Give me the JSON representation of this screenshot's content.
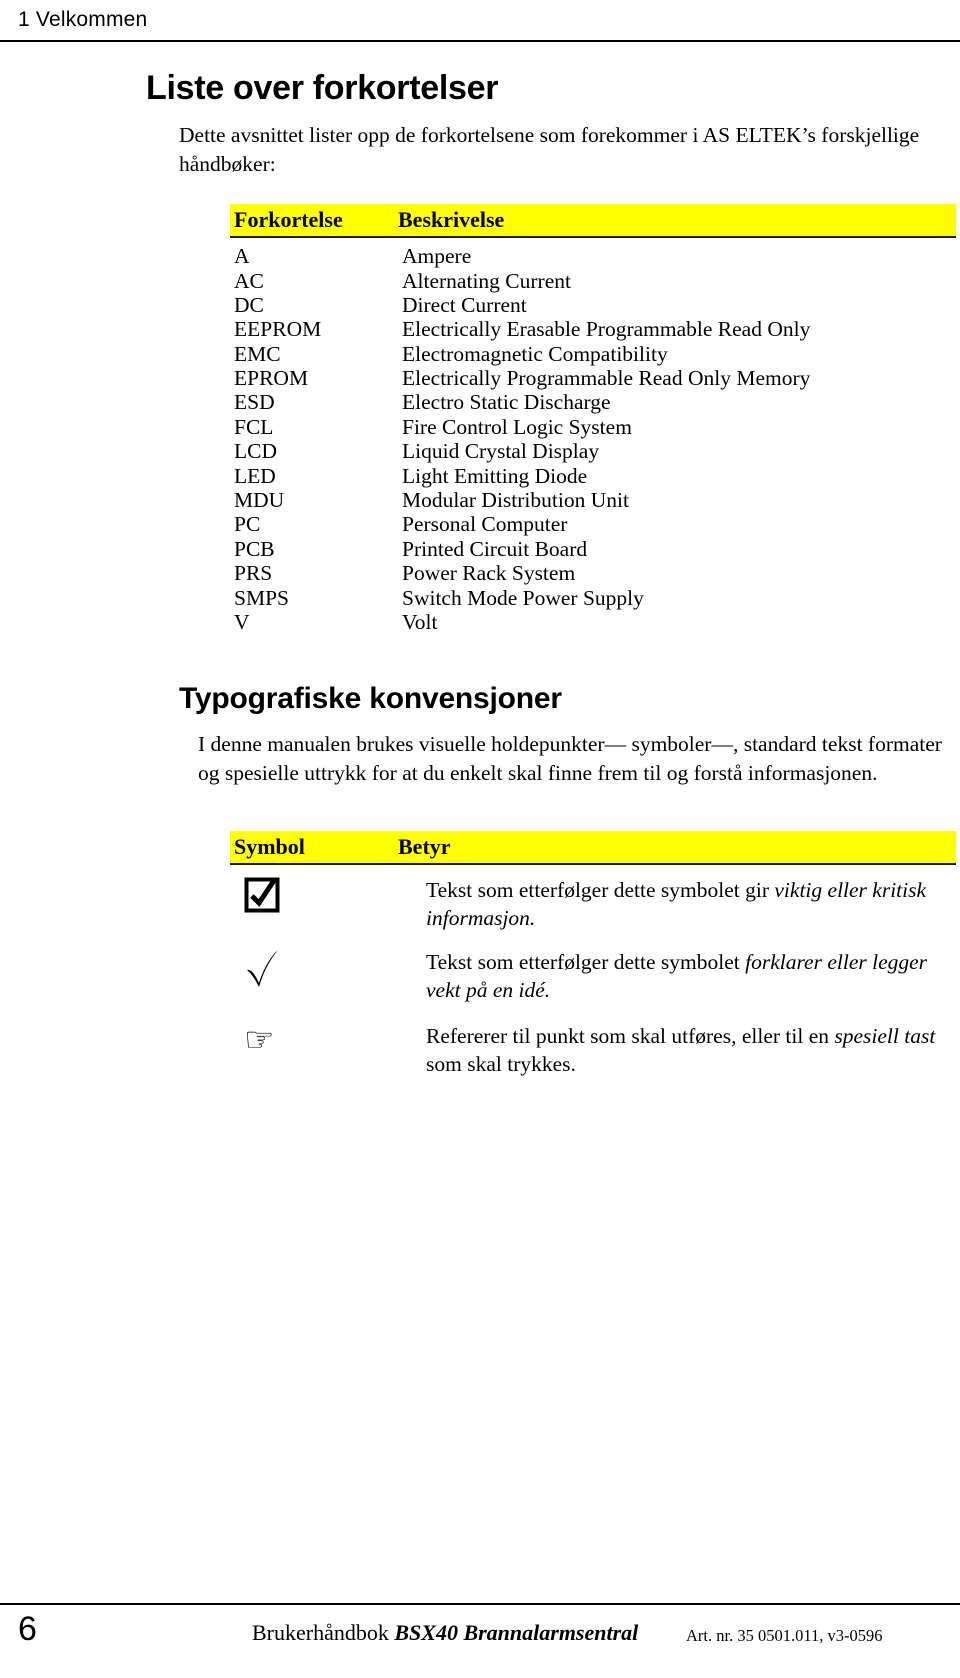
{
  "header": {
    "chapter": "1 Velkommen"
  },
  "abbrev_section": {
    "title": "Liste over forkortelser",
    "intro": "Dette avsnittet lister opp de forkortelsene som forekommer i AS ELTEK’s forskjellige håndbøker:",
    "columns": [
      "Forkortelse",
      "Beskrivelse"
    ],
    "highlight_color": "#ffff00",
    "rows": [
      {
        "key": "A",
        "value": "Ampere"
      },
      {
        "key": "AC",
        "value": "Alternating Current"
      },
      {
        "key": "DC",
        "value": "Direct Current"
      },
      {
        "key": "EEPROM",
        "value": "Electrically Erasable Programmable Read Only"
      },
      {
        "key": "EMC",
        "value": "Electromagnetic Compatibility"
      },
      {
        "key": "EPROM",
        "value": "Electrically Programmable Read Only Memory"
      },
      {
        "key": "ESD",
        "value": "Electro Static Discharge"
      },
      {
        "key": "FCL",
        "value": "Fire Control Logic System"
      },
      {
        "key": "LCD",
        "value": "Liquid Crystal Display"
      },
      {
        "key": "LED",
        "value": "Light Emitting Diode"
      },
      {
        "key": "MDU",
        "value": "Modular Distribution Unit"
      },
      {
        "key": "PC",
        "value": "Personal Computer"
      },
      {
        "key": "PCB",
        "value": "Printed Circuit Board"
      },
      {
        "key": "PRS",
        "value": "Power Rack System"
      },
      {
        "key": "SMPS",
        "value": "Switch Mode Power Supply"
      },
      {
        "key": "V",
        "value": "Volt"
      }
    ]
  },
  "conventions_section": {
    "title": "Typografiske konvensjoner",
    "intro": "I denne manualen brukes visuelle holdepunkter— symboler—, standard tekst formater og spesielle uttrykk for at du enkelt skal finne frem til og forstå informasjonen.",
    "columns": [
      "Symbol",
      "Betyr"
    ],
    "rows": [
      {
        "icon": "checkbox-checked-icon",
        "desc_plain_1": "Tekst som etterfølger dette symbolet gir ",
        "desc_italic_1": "viktig eller kritisk informasjon.",
        "desc_plain_2": ""
      },
      {
        "icon": "checkmark-icon",
        "desc_plain_1": "Tekst som etterfølger dette symbolet ",
        "desc_italic_1": "forklarer eller legger vekt på en idé.",
        "desc_plain_2": ""
      },
      {
        "icon": "pointing-hand-icon",
        "desc_plain_1": "Refererer til punkt som skal utføres, eller til en ",
        "desc_italic_1": "spesiell tast",
        "desc_plain_2": " som skal trykkes."
      }
    ]
  },
  "footer": {
    "page_number": "6",
    "manual_label": "Brukerhåndbok ",
    "manual_title": "BSX40 Brannalarmsentral",
    "article_info": "Art. nr. 35 0501.011, v3-0596"
  }
}
